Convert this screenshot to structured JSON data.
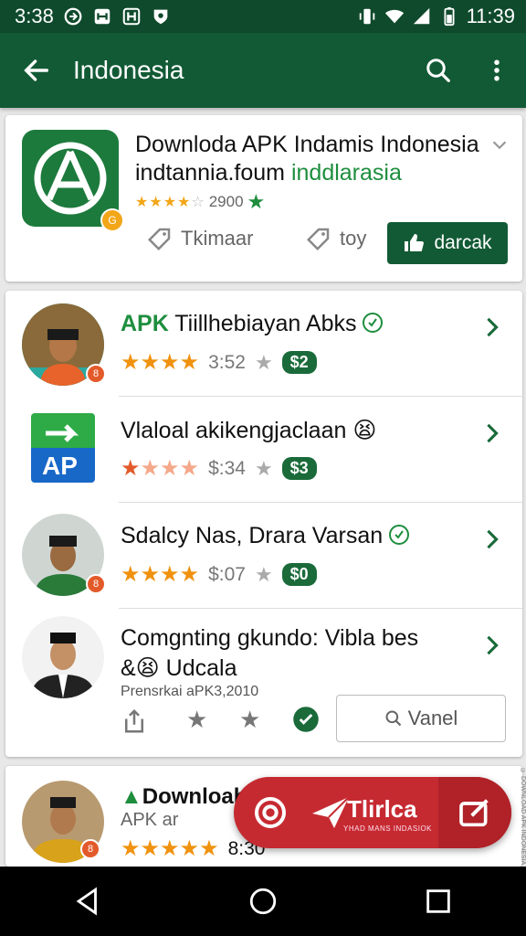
{
  "status": {
    "time_left": "3:38",
    "time_right": "11:39"
  },
  "appbar": {
    "title": "Indonesia"
  },
  "featured": {
    "title_line1": "Downloda APK Indamis Indonesia",
    "title_line2_plain": "indtannia.foum ",
    "title_line2_green": "inddlarasia",
    "rating_count": "2900",
    "action1_label": "Tkimaar",
    "action2_label": "toy",
    "download_label": "darcak"
  },
  "list": {
    "items": [
      {
        "name_prefix": "APK",
        "name": " Tiillhebiayan Abks",
        "rating": "3:52",
        "price": "$2"
      },
      {
        "logo_text": "AP",
        "name": "Vlaloal akikengjaclaan 😫",
        "rating": "$:34",
        "price": "$3"
      },
      {
        "name": "Sdalcy Nas, Drara Varsan",
        "rating": "$:07",
        "price": "$0"
      },
      {
        "name_line1": "Comgnting gkundo: Vibla bes",
        "name_line2": "&😫 Udcala",
        "subtitle": "Prensrkai aPK3,2010",
        "view_label": "Vanel"
      }
    ]
  },
  "bottom_item": {
    "name": "Downloab",
    "sub": "APK ar",
    "rating": "8:30"
  },
  "promo": {
    "brand": "Tlirlca",
    "tagline": "YHAD MANS INDASIOK"
  },
  "side_text": "© DOWNLOAD APK INDONESIA 2019 · ALL RIGHTS"
}
